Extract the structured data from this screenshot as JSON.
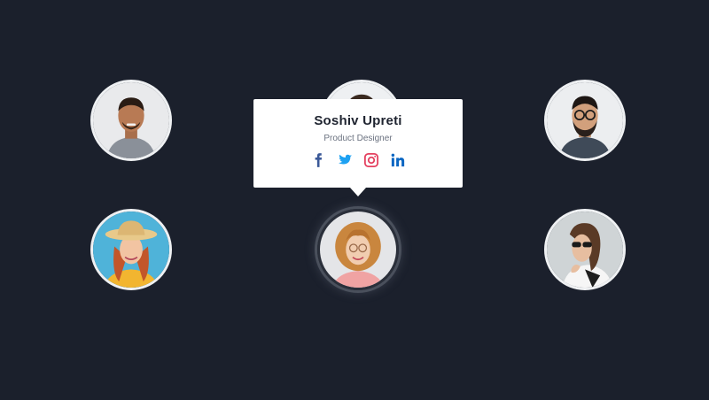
{
  "team": [
    {
      "icon": "person-photo-man-beard"
    },
    {
      "icon": "person-photo-dark-hair"
    },
    {
      "icon": "person-photo-man-glasses"
    },
    {
      "icon": "person-photo-woman-hat"
    },
    {
      "icon": "person-photo-woman-curly-hair",
      "active": true
    },
    {
      "icon": "person-photo-woman-sunglasses"
    }
  ],
  "tooltip": {
    "name": "Soshiv Upreti",
    "role": "Product Designer",
    "social": [
      {
        "icon": "facebook-icon",
        "color": "#3b5998"
      },
      {
        "icon": "twitter-icon",
        "color": "#1da1f2"
      },
      {
        "icon": "instagram-icon",
        "color": "#e4405f"
      },
      {
        "icon": "linkedin-icon",
        "color": "#0a66c2"
      }
    ]
  },
  "colors": {
    "background": "#1b202c",
    "card": "#ffffff",
    "name_text": "#1f2430",
    "role_text": "#6b7280"
  }
}
